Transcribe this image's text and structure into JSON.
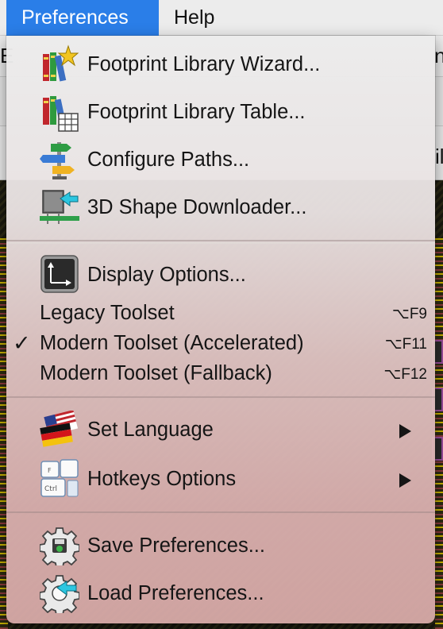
{
  "menubar": {
    "items": [
      {
        "label": "Preferences",
        "active": true
      },
      {
        "label": "Help",
        "active": false
      }
    ]
  },
  "background": {
    "edge_letters": [
      "E",
      "n",
      "il"
    ]
  },
  "menu": {
    "items": [
      {
        "label": "Footprint Library Wizard...",
        "icon": "library-wizard-icon"
      },
      {
        "label": "Footprint Library Table...",
        "icon": "library-table-icon"
      },
      {
        "label": "Configure Paths...",
        "icon": "signpost-icon"
      },
      {
        "label": "3D Shape Downloader...",
        "icon": "3d-download-icon"
      },
      {
        "label": "Display Options...",
        "icon": "display-options-icon"
      },
      {
        "label": "Legacy Toolset",
        "shortcut": "⌥F9",
        "checked": false
      },
      {
        "label": "Modern Toolset (Accelerated)",
        "shortcut": "⌥F11",
        "checked": true,
        "check_mark": "✓"
      },
      {
        "label": "Modern Toolset (Fallback)",
        "shortcut": "⌥F12",
        "checked": false
      },
      {
        "label": "Set Language",
        "icon": "language-flag-icon",
        "submenu": true
      },
      {
        "label": "Hotkeys Options",
        "icon": "hotkeys-icon",
        "submenu": true
      },
      {
        "label": "Save Preferences...",
        "icon": "save-gear-icon"
      },
      {
        "label": "Load Preferences...",
        "icon": "load-gear-icon"
      }
    ],
    "hotkey_icon_keys": [
      "F",
      "Ctrl"
    ]
  },
  "colors": {
    "menubar_active": "#2a7ee8",
    "menu_top": "#ececec",
    "menu_bottom": "#d8aaa8",
    "text": "#151515"
  }
}
